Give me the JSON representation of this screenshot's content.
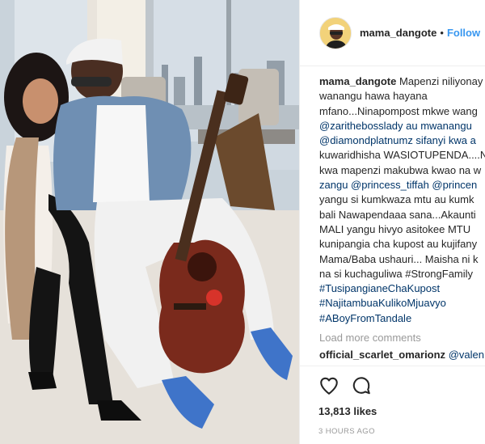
{
  "post": {
    "header": {
      "username": "mama_dangote",
      "separator": "•",
      "follow_label": "Follow"
    },
    "caption": {
      "username": "mama_dangote",
      "lines": [
        "Mapenzi niliyonay",
        "wanangu hawa hayana",
        "mfano...Ninapompost mkwe wang",
        "@zarithebosslady au mwanangu",
        "@diamondplatnumz sifanyi kwa a",
        "kuwaridhisha WASIOTUPENDA....N",
        "kwa mapenzi makubwa kwao na w",
        "zangu @princess_tiffah @princen",
        "yangu si kumkwaza mtu au kumk",
        "bali Nawapendaaa sana...Akaunti",
        "MALI yangu hivyo asitokee MTU",
        "kunipangia cha kupost au kujifany",
        "Mama/Baba ushauri... Maisha ni k",
        "na si kuchaguliwa #StrongFamily",
        "#TusipangianeChaKupost",
        "#NajitambuaKulikoMjuavyo",
        "#ABoyFromTandale"
      ]
    },
    "load_more_label": "Load more comments",
    "comments": [
      {
        "username": "official_scarlet_omarionz",
        "text": "@valen"
      }
    ],
    "likes": "13,813 likes",
    "timestamp": "3 HOURS AGO",
    "icons": [
      "heart-icon",
      "comment-icon"
    ],
    "colors": {
      "link": "#003569",
      "follow": "#3897f0",
      "muted": "#999999",
      "text": "#262626"
    }
  }
}
